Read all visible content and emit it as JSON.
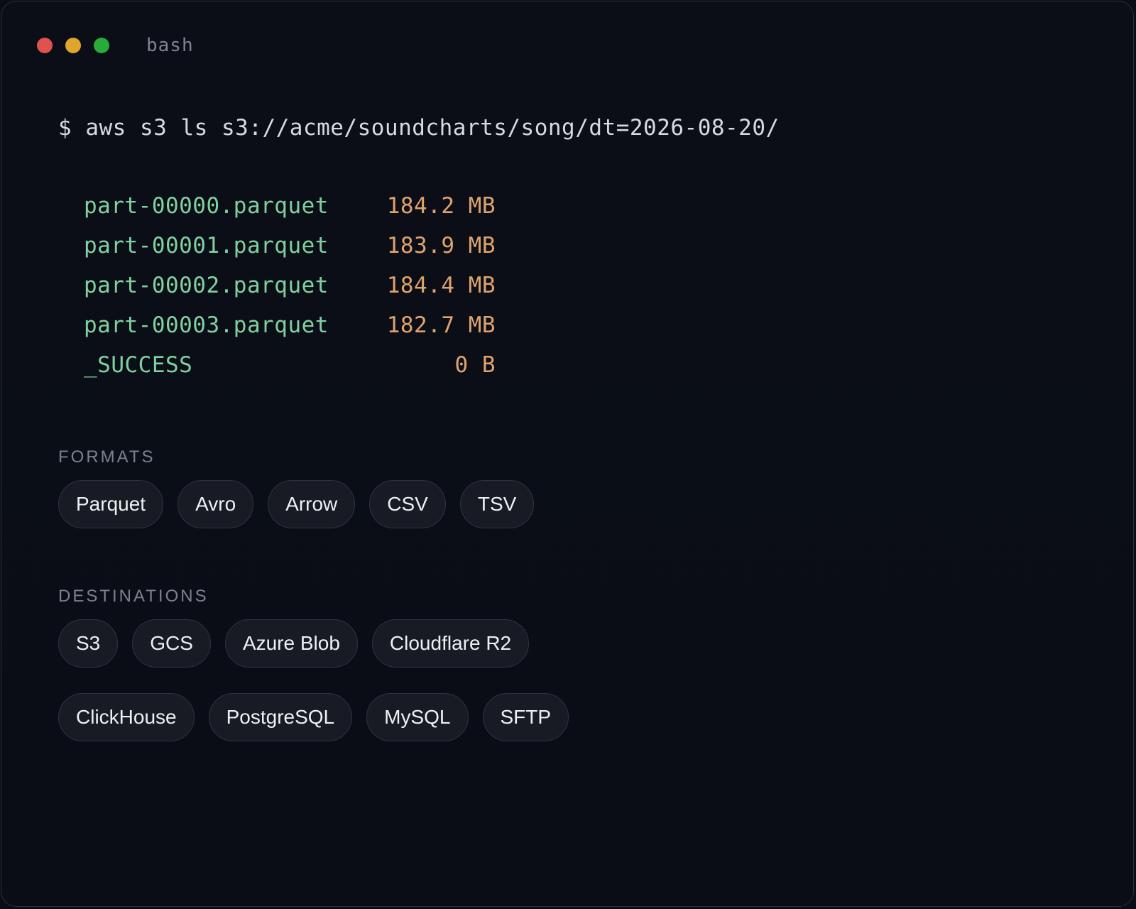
{
  "window": {
    "title": "bash",
    "controls": [
      {
        "name": "close",
        "color": "#e0524f"
      },
      {
        "name": "minimize",
        "color": "#dfa52c"
      },
      {
        "name": "maximize",
        "color": "#27ac3c"
      }
    ]
  },
  "terminal": {
    "command": "$ aws s3 ls s3://acme/soundcharts/song/dt=2026-08-20/",
    "files": [
      {
        "name": "part-00000.parquet",
        "size": "184.2 MB"
      },
      {
        "name": "part-00001.parquet",
        "size": "183.9 MB"
      },
      {
        "name": "part-00002.parquet",
        "size": "184.4 MB"
      },
      {
        "name": "part-00003.parquet",
        "size": "182.7 MB"
      },
      {
        "name": "_SUCCESS",
        "size": "0 B"
      }
    ],
    "colors": {
      "filename": "#7fd1a0",
      "size": "#e0a36e"
    }
  },
  "formats": {
    "label": "FORMATS",
    "items": [
      "Parquet",
      "Avro",
      "Arrow",
      "CSV",
      "TSV"
    ]
  },
  "destinations": {
    "label": "DESTINATIONS",
    "rows": [
      [
        "S3",
        "GCS",
        "Azure Blob",
        "Cloudflare R2"
      ],
      [
        "ClickHouse",
        "PostgreSQL",
        "MySQL",
        "SFTP"
      ]
    ]
  }
}
